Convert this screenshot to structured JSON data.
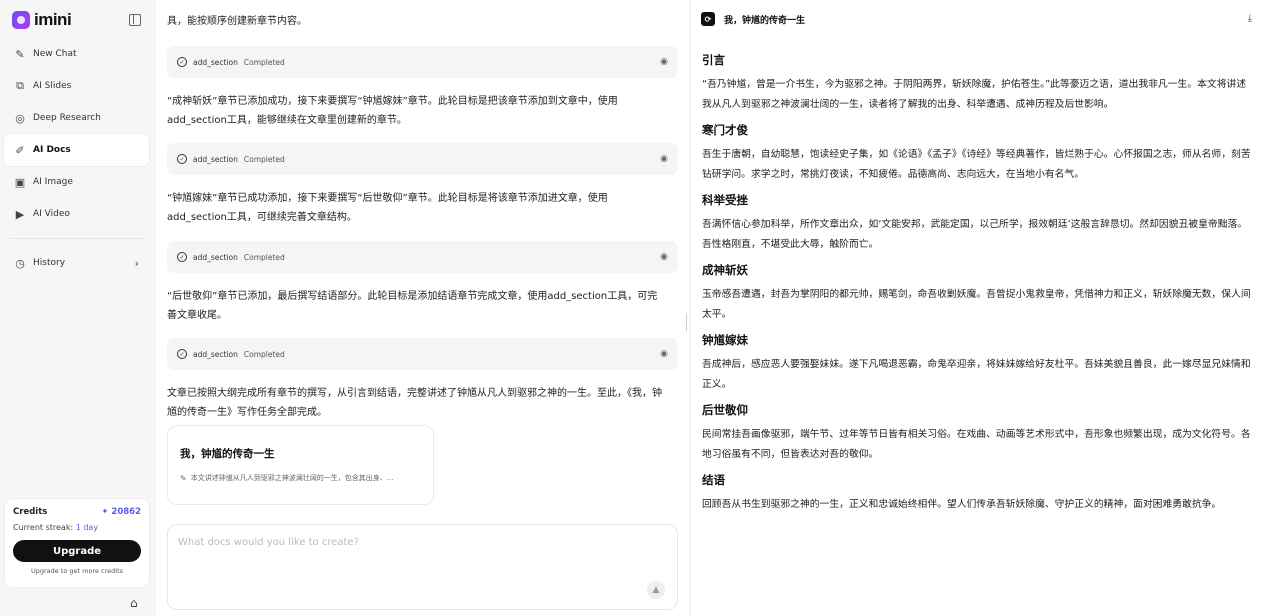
{
  "app": {
    "name": "imini"
  },
  "sidebar": {
    "items": [
      {
        "label": "New Chat",
        "icon": "new-chat-icon"
      },
      {
        "label": "AI Slides",
        "icon": "slides-icon"
      },
      {
        "label": "Deep Research",
        "icon": "research-icon"
      },
      {
        "label": "AI Docs",
        "icon": "docs-icon"
      },
      {
        "label": "AI Image",
        "icon": "image-icon"
      },
      {
        "label": "AI Video",
        "icon": "video-icon"
      }
    ],
    "history_label": "History",
    "credits": {
      "label": "Credits",
      "amount": "20862",
      "streak_label": "Current streak:",
      "streak_value": "1 day",
      "upgrade_label": "Upgrade",
      "upgrade_note": "Upgrade to get more credits"
    }
  },
  "chat": {
    "messages": [
      "具，能按顺序创建新章节内容。",
      "“成神斩妖”章节已添加成功，接下来要撰写“钟馗嫁妹”章节。此轮目标是把该章节添加到文章中，使用add_section工具，能够继续在文章里创建新的章节。",
      "“钟馗嫁妹”章节已成功添加，接下来要撰写“后世敬仰”章节。此轮目标是将该章节添加进文章，使用add_section工具，可继续完善文章结构。",
      "“后世敬仰”章节已添加，最后撰写结语部分。此轮目标是添加结语章节完成文章，使用add_section工具，可完善文章收尾。",
      "文章已按照大纲完成所有章节的撰写，从引言到结语，完整讲述了钟馗从凡人到驱邪之神的一生。至此，《我，钟馗的传奇一生》写作任务全部完成。"
    ],
    "tools": [
      {
        "name": "add_section",
        "status": "Completed"
      },
      {
        "name": "add_section",
        "status": "Completed"
      },
      {
        "name": "add_section",
        "status": "Completed"
      },
      {
        "name": "add_section",
        "status": "Completed"
      }
    ],
    "doc_card": {
      "title": "我，钟馗的传奇一生",
      "desc": "本文讲述钟馗从凡人到驱邪之神波澜壮阔的一生，包含其出身、..."
    },
    "input_placeholder": "What docs would you like to create?"
  },
  "doc": {
    "title": "我，钟馗的传奇一生",
    "sections": [
      {
        "heading": "引言",
        "body": "“吾乃钟馗，曾是一介书生，今为驱邪之神。于阴阳两界，斩妖除魔，护佑苍生。”此等豪迈之语，道出我非凡一生。本文将讲述我从凡人到驱邪之神波澜壮阔的一生，读者将了解我的出身、科举遭遇、成神历程及后世影响。"
      },
      {
        "heading": "寒门才俊",
        "body": "吾生于唐朝，自幼聪慧，饱读经史子集，如《论语》《孟子》《诗经》等经典著作，皆烂熟于心。心怀报国之志，师从名师，刻苦钻研学问。求学之时，常挑灯夜读，不知疲倦。品德高尚、志向远大，在当地小有名气。"
      },
      {
        "heading": "科举受挫",
        "body": "吾满怀信心参加科举，所作文章出众，如‘文能安邦，武能定国，以己所学，报效朝廷’这般言辞恳切。然却因貌丑被皇帝黜落。吾性格刚直，不堪受此大辱，触阶而亡。"
      },
      {
        "heading": "成神斩妖",
        "body": "玉帝感吾遭遇，封吾为掌阴阳的都元帅，赐笔剑，命吾收剿妖魔。吾曾捉小鬼救皇帝，凭借神力和正义，斩妖除魔无数，保人间太平。"
      },
      {
        "heading": "钟馗嫁妹",
        "body": "吾成神后，感应恶人要强娶妹妹。遂下凡喝退恶霸，命鬼卒迎亲，将妹妹嫁给好友杜平。吾妹美貌且善良，此一嫁尽显兄妹情和正义。"
      },
      {
        "heading": "后世敬仰",
        "body": "民间常挂吾画像驱邪，端午节、过年等节日皆有相关习俗。在戏曲、动画等艺术形式中，吾形象也频繁出现，成为文化符号。各地习俗虽有不同，但皆表达对吾的敬仰。"
      },
      {
        "heading": "结语",
        "body": "回顾吾从书生到驱邪之神的一生，正义和忠诚始终相伴。望人们传承吾斩妖除魔、守护正义的精神，面对困难勇敢抗争。"
      }
    ]
  }
}
